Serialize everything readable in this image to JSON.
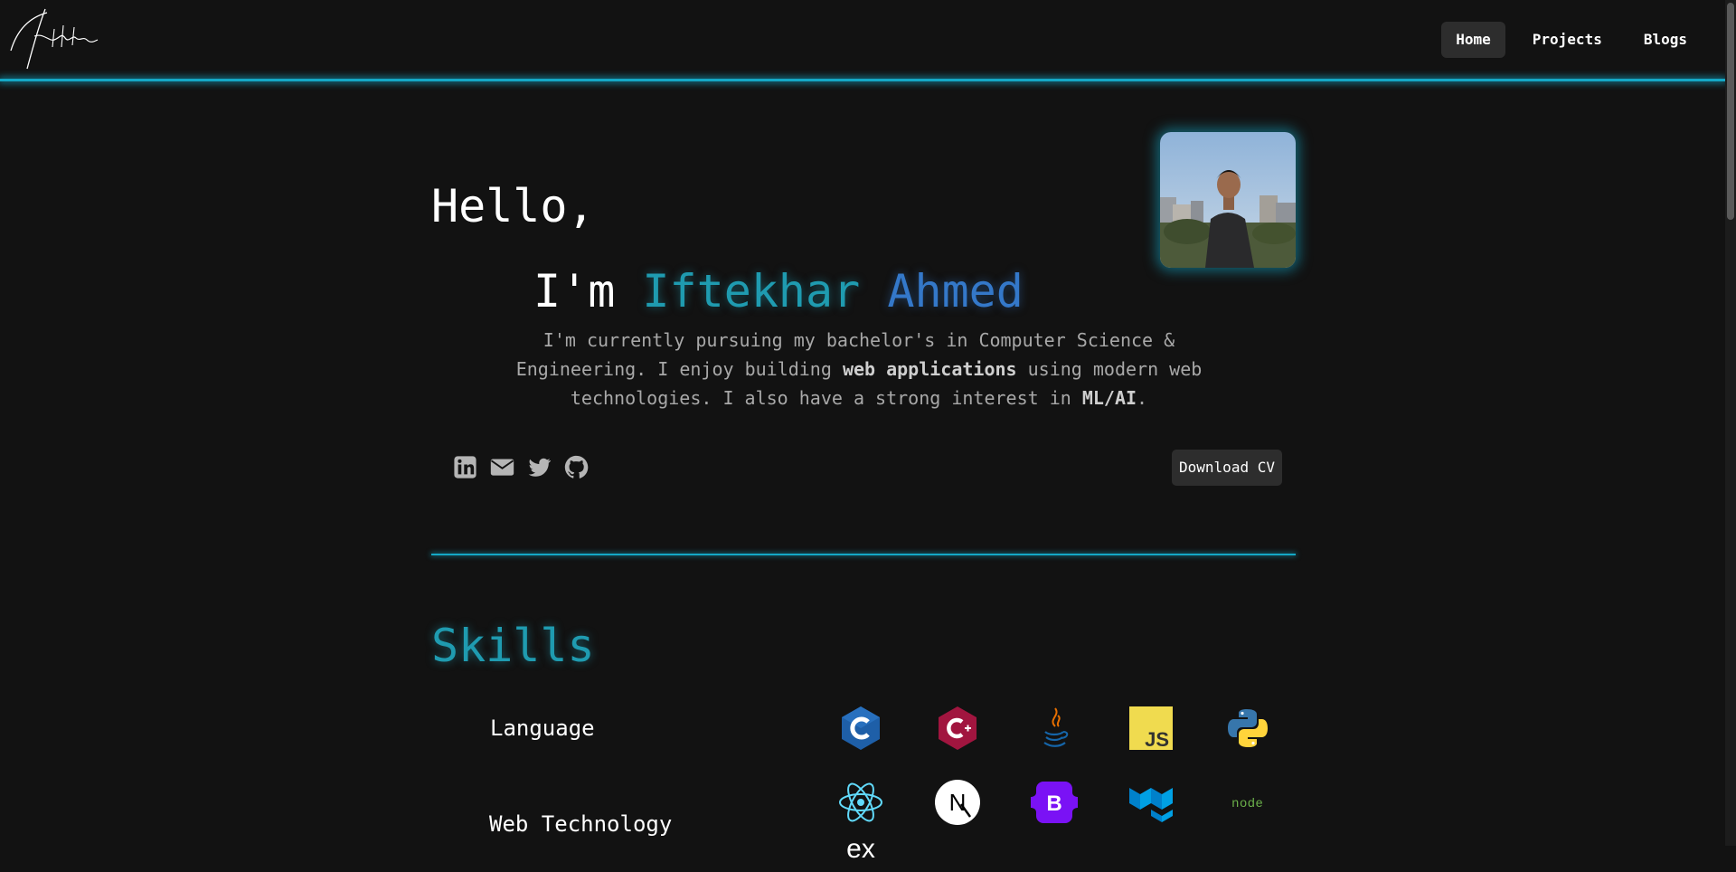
{
  "nav": {
    "logo_text": "Iftekhar",
    "links": [
      {
        "label": "Home",
        "active": true
      },
      {
        "label": "Projects",
        "active": false
      },
      {
        "label": "Blogs",
        "active": false
      }
    ]
  },
  "hero": {
    "greeting": "Hello,",
    "intro_prefix": "I'm",
    "name_first": "Iftekhar",
    "name_last": "Ahmed",
    "bio_part1": "I'm currently pursuing my bachelor's in Computer Science & Engineering. I enjoy building ",
    "bio_bold1": "web applications",
    "bio_part2": " using modern web technologies. I also have a strong interest in ",
    "bio_bold2": "ML/AI",
    "bio_part3": ".",
    "cv_button": "Download CV",
    "socials": [
      "linkedin-icon",
      "email-icon",
      "twitter-icon",
      "github-icon"
    ]
  },
  "skills": {
    "title": "Skills",
    "categories": [
      {
        "name": "Language",
        "items": [
          "c-icon",
          "cpp-icon",
          "java-icon",
          "javascript-icon",
          "python-icon"
        ]
      },
      {
        "name": "Web Technology",
        "items": [
          "react-icon",
          "nextjs-icon",
          "bootstrap-icon",
          "material-ui-icon",
          "nodejs-icon",
          "express-icon"
        ]
      }
    ]
  },
  "colors": {
    "background": "#121212",
    "accent_cyan": "#1f9bb0",
    "accent_blue": "#3478c9",
    "glow_line": "#14a8c6",
    "button_bg": "#2d2d2d",
    "bio_text": "#a8a8a8"
  },
  "icon_text": {
    "javascript": "JS",
    "bootstrap": "B",
    "nextjs": "N",
    "nodejs": "node",
    "express": "ex"
  }
}
